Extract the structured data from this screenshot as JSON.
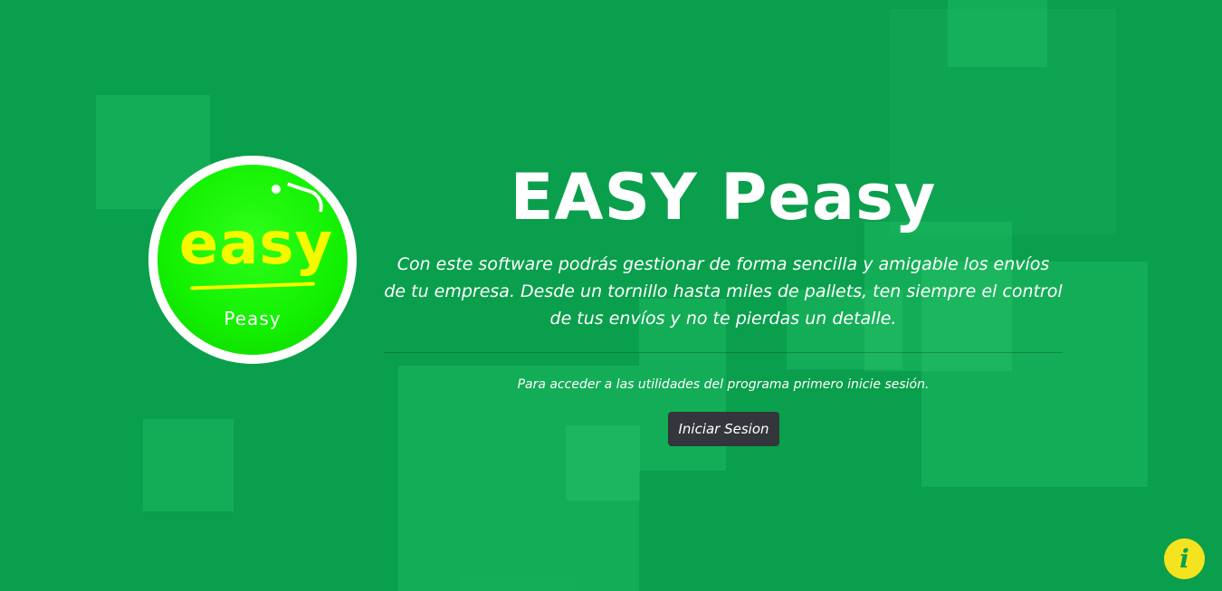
{
  "app": {
    "title": "EASY Peasy",
    "description": "Con este software podrás gestionar de forma sencilla y amigable los envíos de tu empresa. Desde un tornillo hasta miles de pallets, ten siempre el control de tus envíos y no te pierdas un detalle.",
    "access_note": "Para acceder a las utilidades del programa primero inicie sesión."
  },
  "logo": {
    "word_main": "easy",
    "word_sub": "Peasy",
    "colors": {
      "ring": "#ffffff",
      "fill": "#12f000",
      "main_text": "#f6f800",
      "sub_text": "#ffffff"
    }
  },
  "actions": {
    "login_label": "Iniciar Sesion",
    "info_icon": "info-icon"
  },
  "theme": {
    "background": "#0a9f4c",
    "button": "#33363b",
    "info_button": "#f5e320"
  }
}
